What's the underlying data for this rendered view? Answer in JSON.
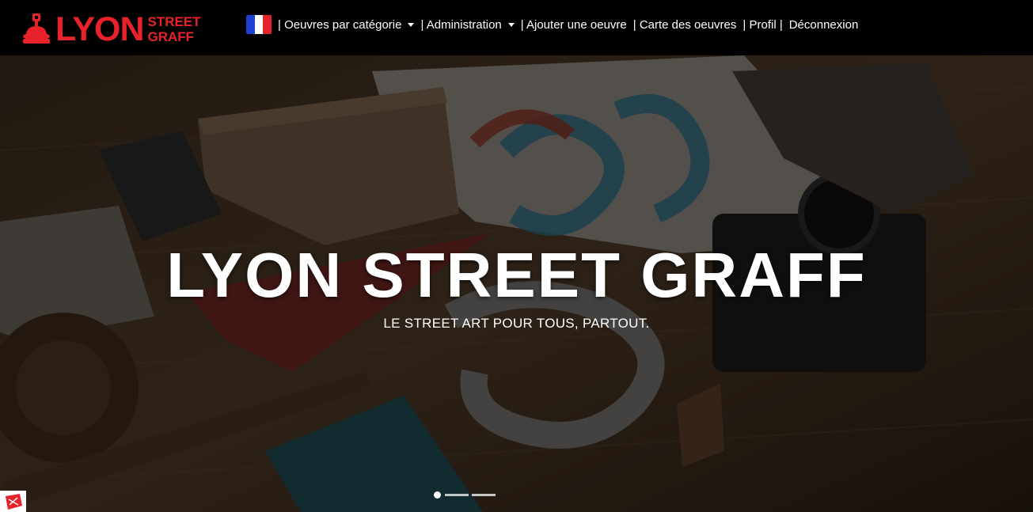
{
  "navbar": {
    "logo": {
      "word": "LYON",
      "line1": "STREET",
      "line2": "GRAFF"
    },
    "flag": {
      "colors": [
        "#1f3fd1",
        "#ffffff",
        "#e3242b"
      ],
      "label": "french-flag-icon"
    },
    "items": [
      {
        "label": "| Oeuvres par catégorie",
        "dropdown": true
      },
      {
        "label": "| Administration",
        "dropdown": true
      },
      {
        "label": "| Ajouter une oeuvre",
        "dropdown": false
      },
      {
        "label": "| Carte des oeuvres",
        "dropdown": false
      },
      {
        "label": "| Profil |",
        "dropdown": false
      },
      {
        "label": "Déconnexion",
        "dropdown": false
      }
    ]
  },
  "hero": {
    "title": "LYON STREET GRAFF",
    "subtitle": "LE STREET ART POUR TOUS, PARTOUT.",
    "slides": {
      "count": 3,
      "active": 1
    }
  },
  "colors": {
    "brand": "#e8222a",
    "navbar_bg": "#000000",
    "text": "#ffffff"
  }
}
